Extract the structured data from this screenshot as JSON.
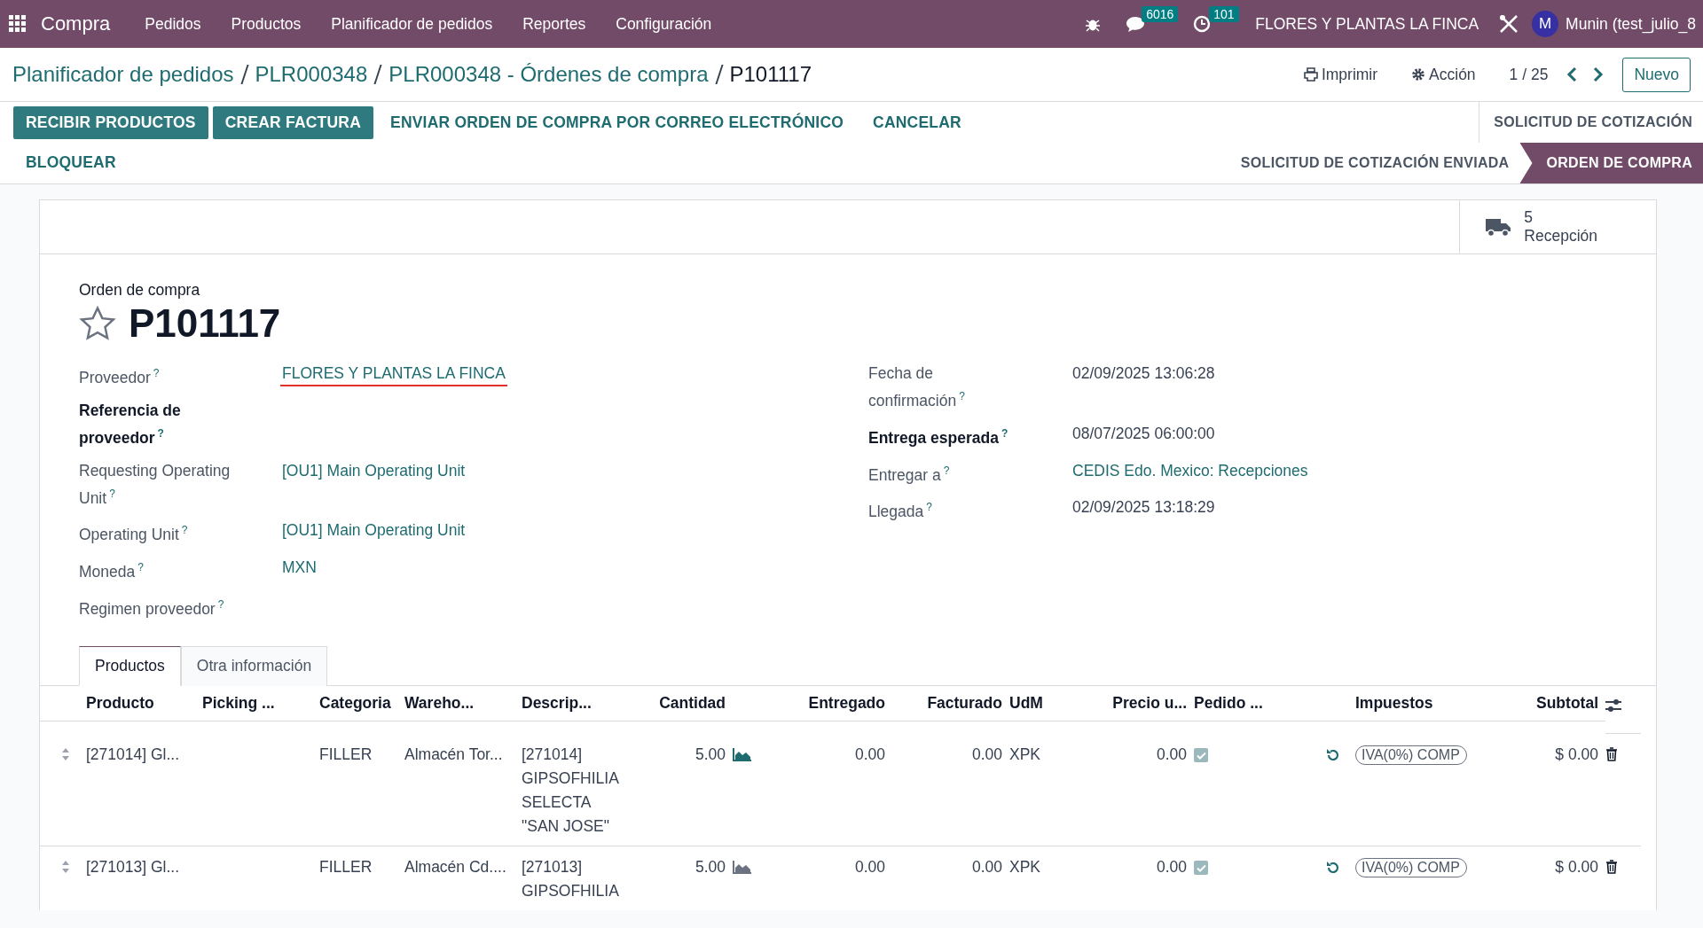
{
  "navbar": {
    "app_name": "Compra",
    "menu": [
      "Pedidos",
      "Productos",
      "Planificador de pedidos",
      "Reportes",
      "Configuración"
    ],
    "messages_badge": "6016",
    "activities_badge": "101",
    "company": "FLORES Y PLANTAS LA FINCA",
    "avatar_letter": "M",
    "user": "Munin (test_julio_8"
  },
  "breadcrumb": [
    "Planificador de pedidos",
    "PLR000348",
    "PLR000348 - Órdenes de compra"
  ],
  "breadcrumb_current": "P101117",
  "control_panel": {
    "print": "Imprimir",
    "action": "Acción",
    "pager": "1 / 25",
    "new_button": "Nuevo"
  },
  "action_buttons": [
    {
      "label": "RECIBIR PRODUCTOS",
      "primary": true
    },
    {
      "label": "CREAR FACTURA",
      "primary": true
    },
    {
      "label": "ENVIAR ORDEN DE COMPRA POR CORREO ELECTRÓNICO",
      "primary": false
    },
    {
      "label": "CANCELAR",
      "primary": false
    },
    {
      "label": "BLOQUEAR",
      "primary": false
    }
  ],
  "status_stages": [
    {
      "label": "SOLICITUD DE COTIZACIÓN",
      "selected": false
    },
    {
      "label": "SOLICITUD DE COTIZACIÓN ENVIADA",
      "selected": false
    },
    {
      "label": "ORDEN DE COMPRA",
      "selected": true
    }
  ],
  "smart_button": {
    "count": "5",
    "label": "Recepción"
  },
  "form": {
    "subtitle": "Orden de compra",
    "title": "P101117",
    "starred": false,
    "left_fields": [
      {
        "label": "Proveedor",
        "help": "?",
        "required": false,
        "value": "FLORES Y PLANTAS LA FINCA",
        "link": true,
        "flagged": true
      },
      {
        "label": "Referencia de proveedor",
        "help": "?",
        "required": true
      },
      {
        "label": "Requesting Operating Unit",
        "help": "?",
        "required": false,
        "value": "[OU1] Main Operating Unit",
        "link": true,
        "flagged": false
      },
      {
        "label": "Operating Unit",
        "help": "?",
        "required": false,
        "value": "[OU1] Main Operating Unit",
        "link": true,
        "flagged": false
      },
      {
        "label": "Moneda",
        "help": "?",
        "required": false,
        "value": "MXN",
        "link": true,
        "flagged": false
      },
      {
        "label": "Regimen proveedor",
        "help": "?",
        "required": false
      }
    ],
    "right_fields": [
      {
        "label": "Fecha de confirmación",
        "help": "?",
        "required": false,
        "value": "02/09/2025 13:06:28",
        "link": false,
        "flagged": false
      },
      {
        "label": "Entrega esperada",
        "help": "?",
        "required": true,
        "value": "08/07/2025 06:00:00",
        "link": false,
        "flagged": false
      },
      {
        "label": "Entregar a",
        "help": "?",
        "required": false,
        "value": "CEDIS Edo. Mexico: Recepciones",
        "link": true,
        "flagged": false
      },
      {
        "label": "Llegada",
        "help": "?",
        "required": false,
        "value": "02/09/2025 13:18:29",
        "link": false,
        "flagged": false
      }
    ]
  },
  "tabs": [
    {
      "label": "Productos",
      "selected": true
    },
    {
      "label": "Otra información",
      "selected": false
    }
  ],
  "table": {
    "columns": [
      "Producto",
      "Picking ...",
      "Categoria",
      "Wareho...",
      "Descrip...",
      "Cantidad",
      "Entregado",
      "Facturado",
      "UdM",
      "Precio u...",
      "Pedido ...",
      "Impuestos",
      "Subtotal"
    ],
    "rows": [
      {
        "product": "[271014] Gl...",
        "category": "FILLER",
        "warehouse": "Almacén Tor...",
        "description": "[271014] GIPSOFHILIA SELECTA \"SAN JOSE\"",
        "quantity": "5.00",
        "forecast_ok": true,
        "delivered": "0.00",
        "invoiced": "0.00",
        "uom": "XPK",
        "price": "0.00",
        "ordered": true,
        "tax": "IVA(0%) COMP",
        "subtotal": "$ 0.00"
      },
      {
        "product": "[271013] Gl...",
        "category": "FILLER",
        "warehouse": "Almacén Cd....",
        "description": "[271013] GIPSOFHILIA",
        "quantity": "5.00",
        "forecast_ok": false,
        "delivered": "0.00",
        "invoiced": "0.00",
        "uom": "XPK",
        "price": "0.00",
        "ordered": true,
        "tax": "IVA(0%) COMP",
        "subtotal": "$ 0.00"
      }
    ]
  }
}
